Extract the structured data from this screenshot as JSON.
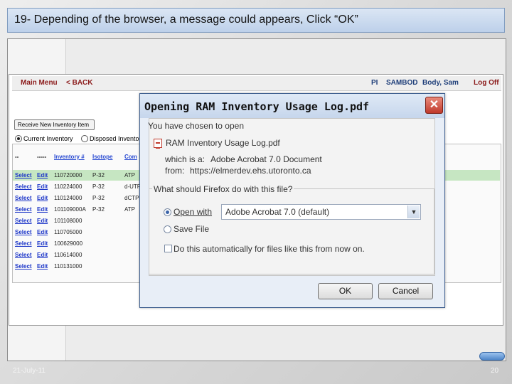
{
  "slide": {
    "title": "19- Depending of the browser, a message could appears, Click “OK”",
    "footer_date": "21-July-11",
    "page_number": "20"
  },
  "app": {
    "main_menu": "Main Menu",
    "back": "< BACK",
    "pi_label": "PI",
    "pi_name": "SAMBOD",
    "user": "Body, Sam",
    "logoff": "Log Off",
    "receive_button": "Receive New Inventory Item",
    "radio_current": "Current Inventory",
    "radio_disposed": "Disposed Invento",
    "columns": [
      "--",
      "-----",
      "Inventory #",
      "Isotope",
      "Com"
    ],
    "rows": [
      {
        "select": "Select",
        "edit": "Edit",
        "inv": "110720000",
        "iso": "P-32",
        "com": "ATP",
        "highlight": true
      },
      {
        "select": "Select",
        "edit": "Edit",
        "inv": "110224000",
        "iso": "P-32",
        "com": "d-UTP"
      },
      {
        "select": "Select",
        "edit": "Edit",
        "inv": "110124000",
        "iso": "P-32",
        "com": "dCTP"
      },
      {
        "select": "Select",
        "edit": "Edit",
        "inv": "101109000A",
        "iso": "P-32",
        "com": "ATP"
      },
      {
        "select": "Select",
        "edit": "Edit",
        "inv": "101108000",
        "iso": "",
        "com": ""
      },
      {
        "select": "Select",
        "edit": "Edit",
        "inv": "110705000",
        "iso": "",
        "com": ""
      },
      {
        "select": "Select",
        "edit": "Edit",
        "inv": "100629000",
        "iso": "",
        "com": ""
      },
      {
        "select": "Select",
        "edit": "Edit",
        "inv": "110614000",
        "iso": "",
        "com": ""
      },
      {
        "select": "Select",
        "edit": "Edit",
        "inv": "110131000",
        "iso": "",
        "com": ""
      }
    ]
  },
  "dialog": {
    "title": "Opening RAM Inventory Usage Log.pdf",
    "close_symbol": "✕",
    "chosen_text": "You have chosen to open",
    "file_name": "RAM Inventory Usage Log.pdf",
    "which_is_label": "which is a:",
    "which_is_value": "Adobe Acrobat 7.0 Document",
    "from_label": "from:",
    "from_value": "https://elmerdev.ehs.utoronto.ca",
    "question": "What should Firefox do with this file?",
    "open_with_label": "Open with",
    "open_with_value": "Adobe Acrobat 7.0 (default)",
    "save_file_label": "Save File",
    "auto_label": "Do this automatically for files like this from now on.",
    "ok": "OK",
    "cancel": "Cancel",
    "icons": {
      "file": "pdf-file-icon",
      "close": "close-icon",
      "dropdown": "chevron-down-icon"
    }
  }
}
